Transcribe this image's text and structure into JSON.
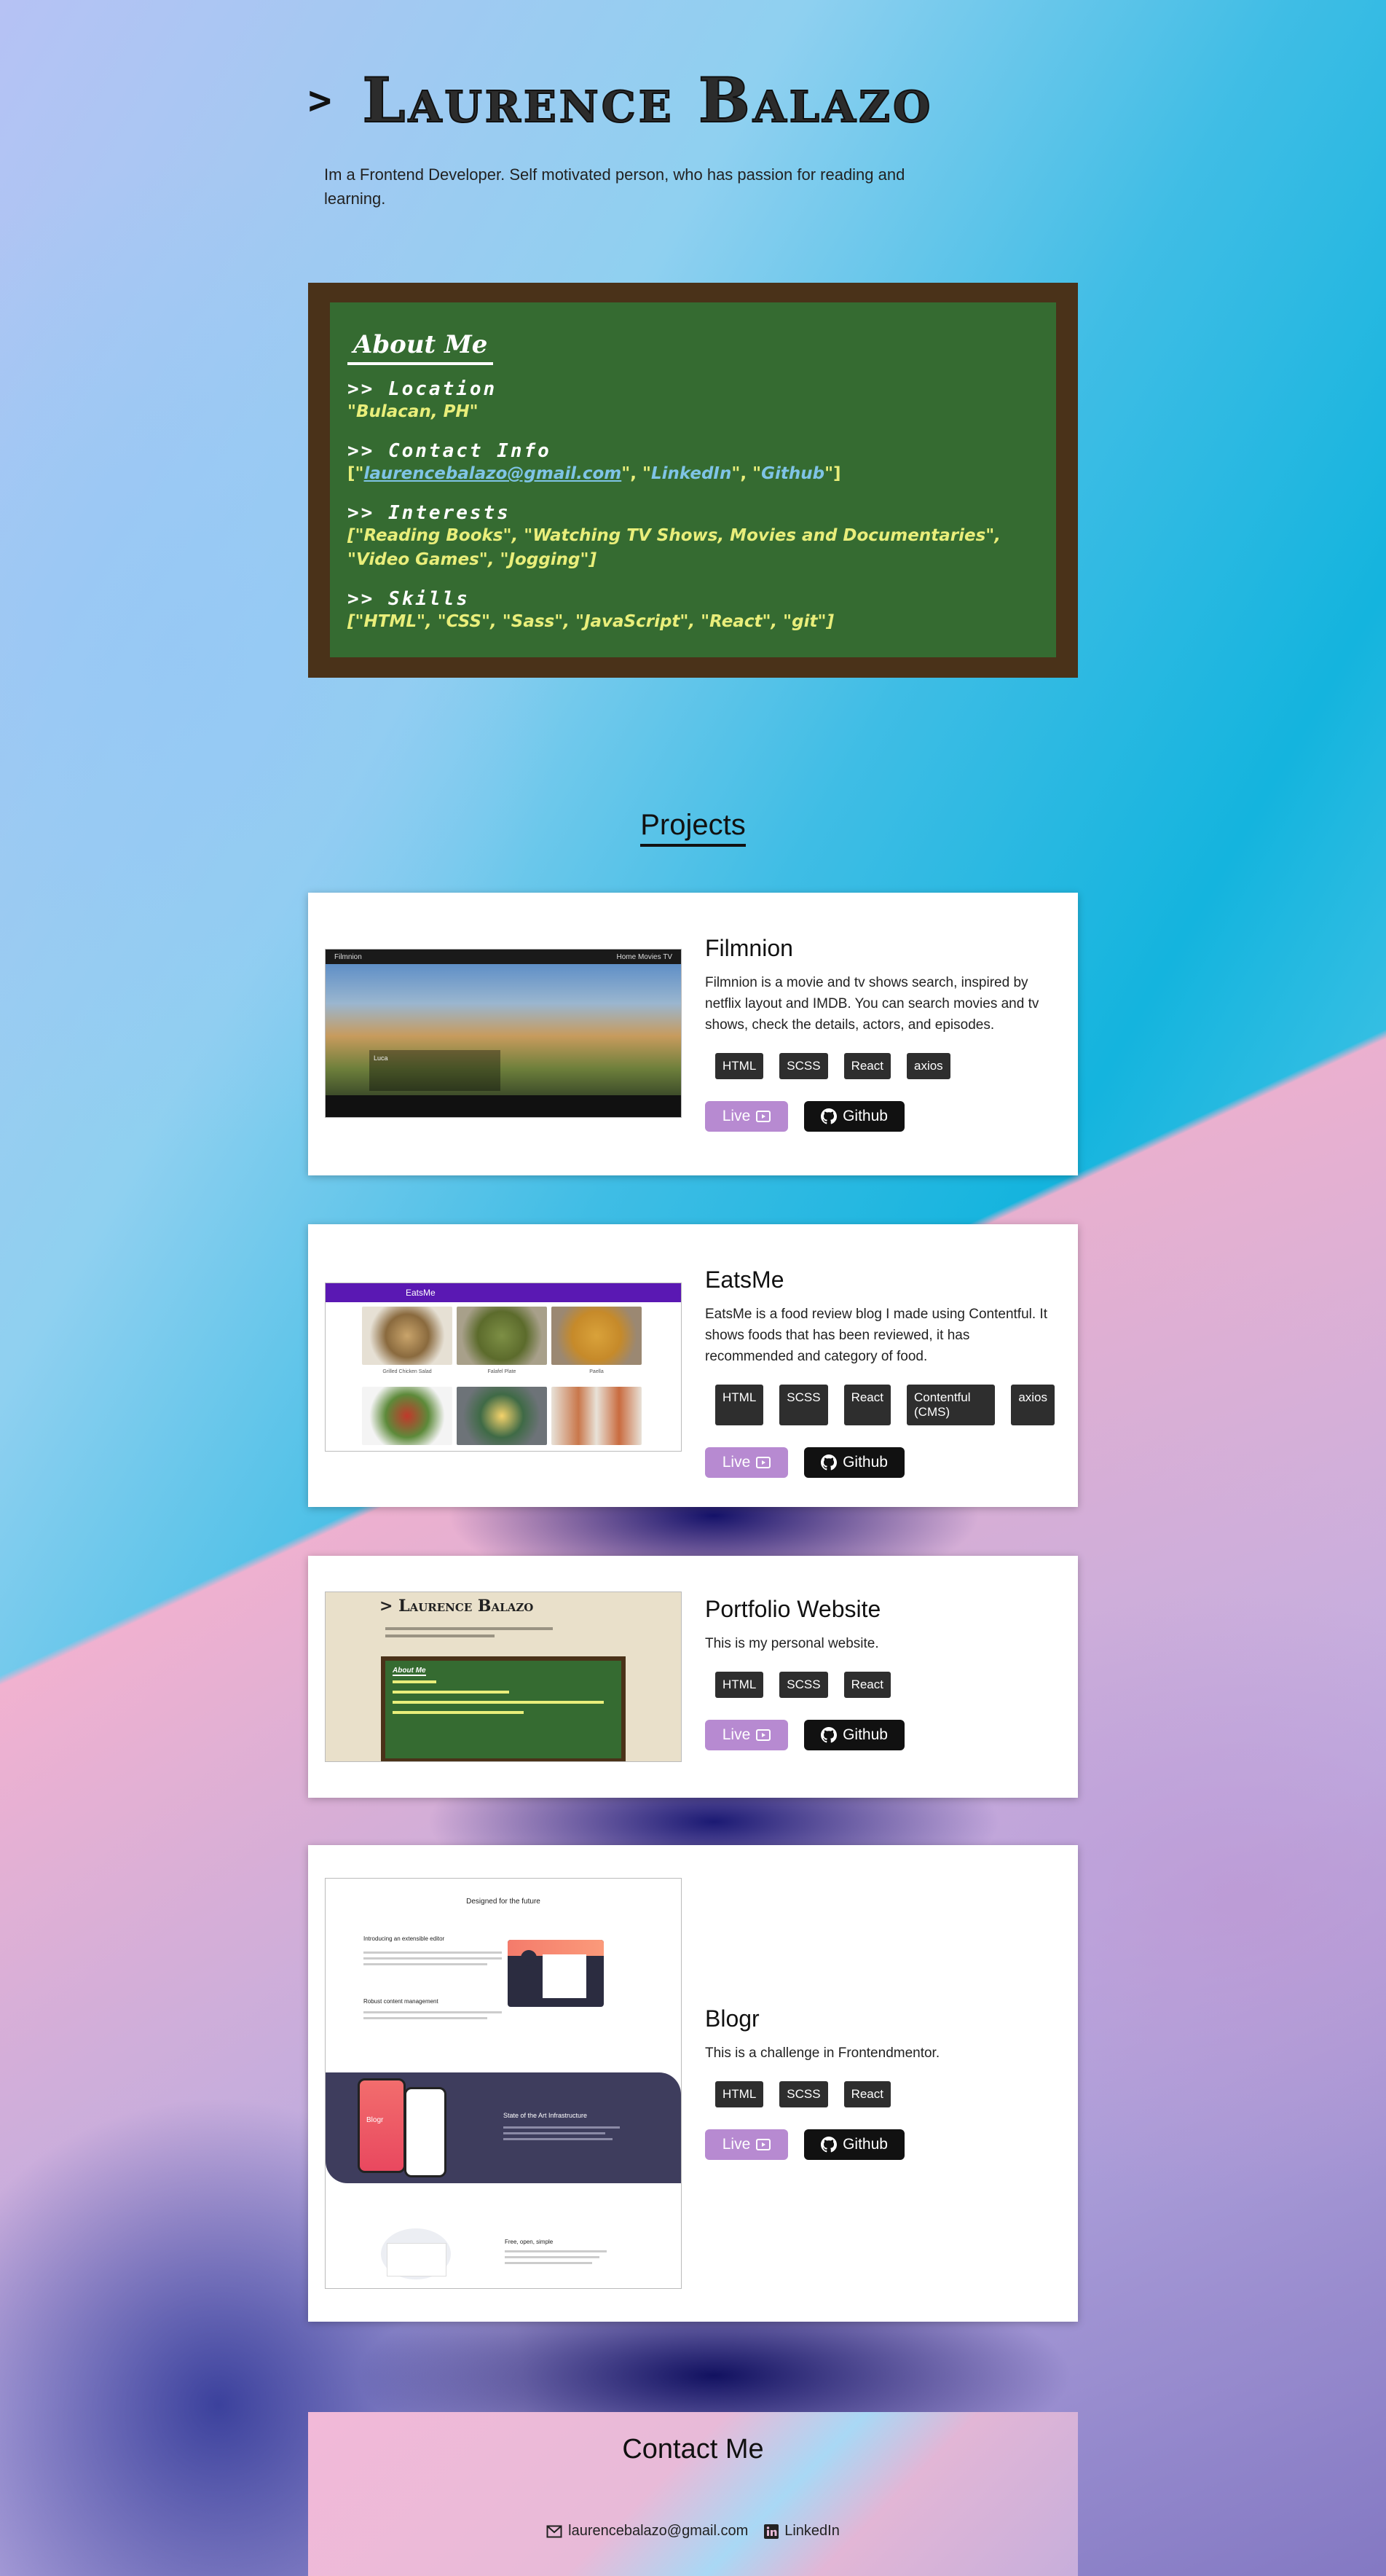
{
  "header": {
    "prompt_symbol": ">",
    "name": "Laurence Balazo",
    "intro": "Im a Frontend Developer. Self motivated person, who has passion for reading and learning."
  },
  "about": {
    "title": "About Me",
    "location": {
      "label": ">> Location",
      "value": "\"Bulacan, PH\""
    },
    "contact": {
      "label": ">> Contact Info",
      "open": "[\"",
      "email": "laurencebalazo@gmail.com",
      "sep1": "\", \"",
      "linkedin": "LinkedIn",
      "sep2": "\", \"",
      "github": "Github",
      "close": "\"]"
    },
    "interests": {
      "label": ">> Interests",
      "value": "[\"Reading Books\", \"Watching TV Shows, Movies and Documentaries\", \"Video Games\", \"Jogging\"]"
    },
    "skills": {
      "label": ">> Skills",
      "value": "[\"HTML\", \"CSS\", \"Sass\", \"JavaScript\", \"React\", \"git\"]"
    }
  },
  "projects": {
    "title": "Projects",
    "live_label": "Live",
    "github_label": "Github",
    "items": [
      {
        "name": "Filmnion",
        "description": "Filmnion is a movie and tv shows search, inspired by netflix layout and IMDB. You can search movies and tv shows, check the details, actors, and episodes.",
        "tags": [
          "HTML",
          "SCSS",
          "React",
          "axios"
        ],
        "thumb_brand": "Filmnion",
        "thumb_nav": "Home  Movies  TV",
        "thumb_caption": "Luca"
      },
      {
        "name": "EatsMe",
        "description": "EatsMe is a food review blog I made using Contentful. It shows foods that has been reviewed, it has recommended and category of food.",
        "tags": [
          "HTML",
          "SCSS",
          "React",
          "Contentful (CMS)",
          "axios"
        ],
        "thumb_brand": "EatsMe",
        "thumb_captions": [
          "Grilled Chicken Salad",
          "Falafel Plate",
          "Paella"
        ]
      },
      {
        "name": "Portfolio Website",
        "description": "This is my personal website.",
        "tags": [
          "HTML",
          "SCSS",
          "React"
        ],
        "thumb_title": "> Laurence Balazo",
        "thumb_board": "About Me"
      },
      {
        "name": "Blogr",
        "description": "This is a challenge in Frontendmentor.",
        "tags": [
          "HTML",
          "SCSS",
          "React"
        ],
        "thumb_head": "Designed for the future",
        "thumb_sub": "Introducing an extensible editor",
        "thumb_sub2": "Robust content management",
        "thumb_band": "State of the Art Infrastructure",
        "thumb_band_logo": "Blogr",
        "thumb_free": "Free, open, simple"
      }
    ]
  },
  "contact": {
    "title": "Contact Me",
    "email": "laurencebalazo@gmail.com",
    "linkedin": "LinkedIn"
  },
  "colors": {
    "board_frame": "#4a3219",
    "board_green": "#356b31",
    "live_button": "#b78ad1",
    "github_button": "#111111",
    "tag": "#2e2e2e"
  }
}
